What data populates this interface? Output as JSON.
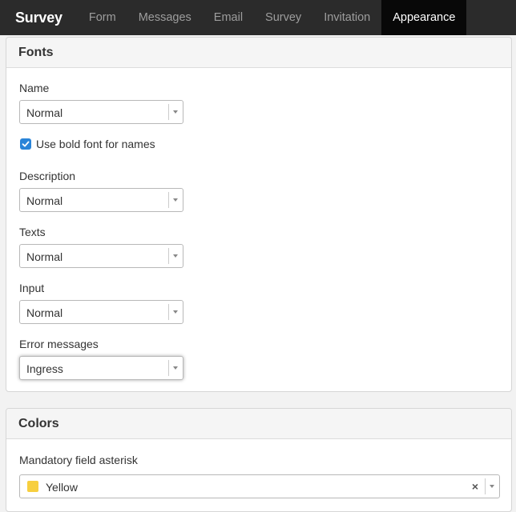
{
  "navbar": {
    "brand": "Survey",
    "items": [
      {
        "label": "Form",
        "active": false
      },
      {
        "label": "Messages",
        "active": false
      },
      {
        "label": "Email",
        "active": false
      },
      {
        "label": "Survey",
        "active": false
      },
      {
        "label": "Invitation",
        "active": false
      },
      {
        "label": "Appearance",
        "active": true
      }
    ]
  },
  "fonts": {
    "heading": "Fonts",
    "name_label": "Name",
    "name_value": "Normal",
    "bold_checkbox_label": "Use bold font for names",
    "bold_checked": true,
    "description_label": "Description",
    "description_value": "Normal",
    "texts_label": "Texts",
    "texts_value": "Normal",
    "input_label": "Input",
    "input_value": "Normal",
    "error_label": "Error messages",
    "error_value": "Ingress"
  },
  "colors": {
    "heading": "Colors",
    "asterisk_label": "Mandatory field asterisk",
    "asterisk_value": "Yellow",
    "asterisk_swatch": "#f7cf3f",
    "clear_symbol": "×"
  },
  "theme": {
    "navbar_bg": "#2b2b2b",
    "navbar_active_bg": "#080808",
    "checkbox_color": "#2a84d8"
  }
}
